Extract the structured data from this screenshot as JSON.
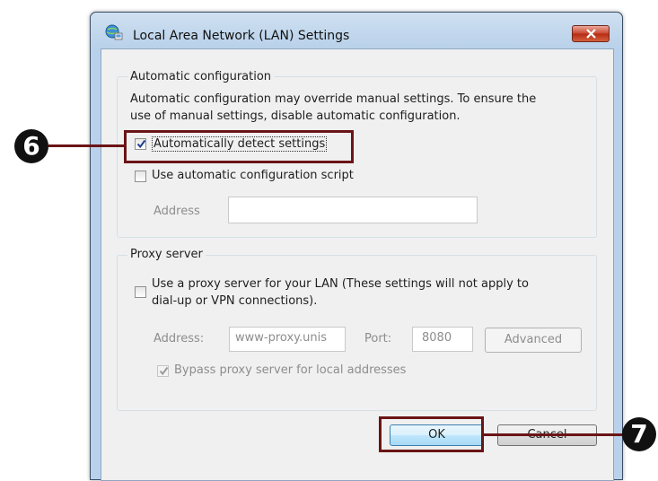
{
  "window": {
    "title": "Local Area Network (LAN) Settings",
    "icon": "network-settings-icon",
    "close_icon": "close-icon"
  },
  "automatic_configuration": {
    "legend": "Automatic configuration",
    "description_line1": "Automatic configuration may override manual settings.  To ensure the",
    "description_line2": "use of manual settings, disable automatic configuration.",
    "auto_detect": {
      "label": "Automatically detect settings",
      "checked": true
    },
    "auto_script": {
      "label": "Use automatic configuration script",
      "checked": false
    },
    "address": {
      "label": "Address",
      "value": ""
    }
  },
  "proxy_server": {
    "legend": "Proxy server",
    "use_proxy": {
      "label_line1": "Use a proxy server for your LAN (These settings will not apply to",
      "label_line2": "dial-up or VPN connections).",
      "checked": false
    },
    "address": {
      "label": "Address:",
      "value": "www-proxy.unis"
    },
    "port": {
      "label": "Port:",
      "value": "8080"
    },
    "advanced_label": "Advanced",
    "bypass": {
      "label": "Bypass proxy server for local addresses",
      "checked": true
    }
  },
  "buttons": {
    "ok": "OK",
    "cancel": "Cancel"
  },
  "callouts": [
    {
      "number": "6",
      "target": "auto-detect-checkbox"
    },
    {
      "number": "7",
      "target": "ok-button"
    }
  ],
  "colors": {
    "callout": "#6b1416",
    "badge": "#111111"
  }
}
